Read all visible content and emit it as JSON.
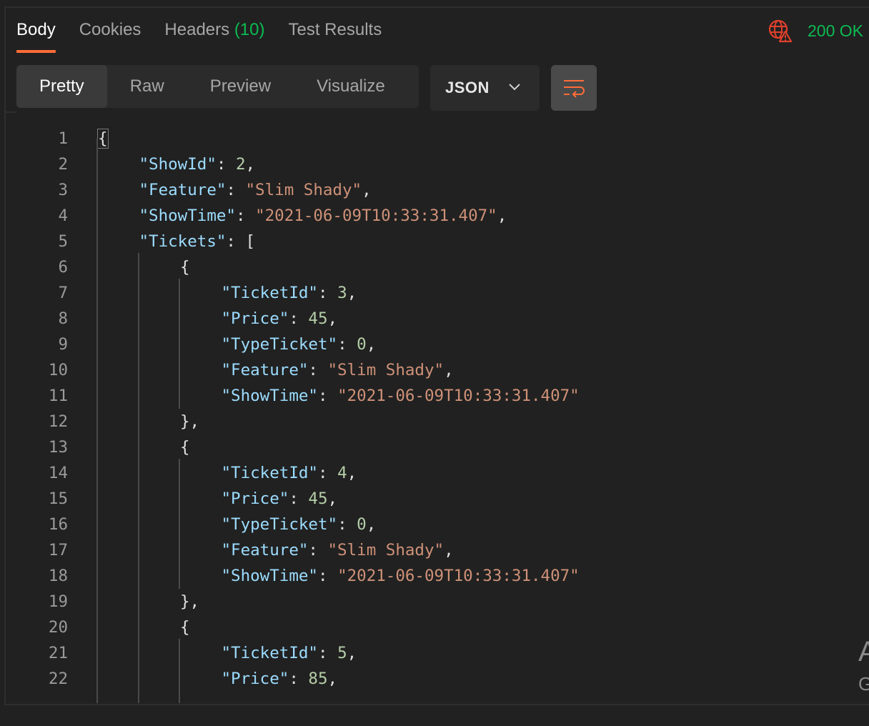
{
  "response_tabs": [
    {
      "label": "Body",
      "active": true
    },
    {
      "label": "Cookies",
      "active": false
    },
    {
      "label": "Headers ",
      "count": "(10)",
      "active": false
    },
    {
      "label": "Test Results",
      "active": false
    }
  ],
  "status": {
    "text": "200 OK",
    "color": "#0cbb52",
    "icon": "globe-warning-icon"
  },
  "view_modes": [
    {
      "label": "Pretty",
      "active": true
    },
    {
      "label": "Raw",
      "active": false
    },
    {
      "label": "Preview",
      "active": false
    },
    {
      "label": "Visualize",
      "active": false
    }
  ],
  "format": {
    "selected": "JSON",
    "icon": "chevron-down-icon"
  },
  "wrap_button": {
    "icon": "wrap-lines-icon"
  },
  "colors": {
    "accent": "#ff6c37",
    "json_key": "#9cdcfe",
    "json_string": "#ce9178",
    "json_number": "#b5cea8"
  },
  "code_lines": [
    {
      "n": "1",
      "indent": 0,
      "tokens": [
        {
          "t": "{",
          "c": "p",
          "hl": true
        }
      ]
    },
    {
      "n": "2",
      "indent": 1,
      "tokens": [
        {
          "t": "\"ShowId\"",
          "c": "k"
        },
        {
          "t": ": ",
          "c": "p"
        },
        {
          "t": "2",
          "c": "n"
        },
        {
          "t": ",",
          "c": "p"
        }
      ]
    },
    {
      "n": "3",
      "indent": 1,
      "tokens": [
        {
          "t": "\"Feature\"",
          "c": "k"
        },
        {
          "t": ": ",
          "c": "p"
        },
        {
          "t": "\"Slim Shady\"",
          "c": "s"
        },
        {
          "t": ",",
          "c": "p"
        }
      ]
    },
    {
      "n": "4",
      "indent": 1,
      "tokens": [
        {
          "t": "\"ShowTime\"",
          "c": "k"
        },
        {
          "t": ": ",
          "c": "p"
        },
        {
          "t": "\"2021-06-09T10:33:31.407\"",
          "c": "s"
        },
        {
          "t": ",",
          "c": "p"
        }
      ]
    },
    {
      "n": "5",
      "indent": 1,
      "tokens": [
        {
          "t": "\"Tickets\"",
          "c": "k"
        },
        {
          "t": ": [",
          "c": "p"
        }
      ]
    },
    {
      "n": "6",
      "indent": 2,
      "tokens": [
        {
          "t": "{",
          "c": "p"
        }
      ]
    },
    {
      "n": "7",
      "indent": 3,
      "tokens": [
        {
          "t": "\"TicketId\"",
          "c": "k"
        },
        {
          "t": ": ",
          "c": "p"
        },
        {
          "t": "3",
          "c": "n"
        },
        {
          "t": ",",
          "c": "p"
        }
      ]
    },
    {
      "n": "8",
      "indent": 3,
      "tokens": [
        {
          "t": "\"Price\"",
          "c": "k"
        },
        {
          "t": ": ",
          "c": "p"
        },
        {
          "t": "45",
          "c": "n"
        },
        {
          "t": ",",
          "c": "p"
        }
      ]
    },
    {
      "n": "9",
      "indent": 3,
      "tokens": [
        {
          "t": "\"TypeTicket\"",
          "c": "k"
        },
        {
          "t": ": ",
          "c": "p"
        },
        {
          "t": "0",
          "c": "n"
        },
        {
          "t": ",",
          "c": "p"
        }
      ]
    },
    {
      "n": "10",
      "indent": 3,
      "tokens": [
        {
          "t": "\"Feature\"",
          "c": "k"
        },
        {
          "t": ": ",
          "c": "p"
        },
        {
          "t": "\"Slim Shady\"",
          "c": "s"
        },
        {
          "t": ",",
          "c": "p"
        }
      ]
    },
    {
      "n": "11",
      "indent": 3,
      "tokens": [
        {
          "t": "\"ShowTime\"",
          "c": "k"
        },
        {
          "t": ": ",
          "c": "p"
        },
        {
          "t": "\"2021-06-09T10:33:31.407\"",
          "c": "s"
        }
      ]
    },
    {
      "n": "12",
      "indent": 2,
      "tokens": [
        {
          "t": "},",
          "c": "p"
        }
      ]
    },
    {
      "n": "13",
      "indent": 2,
      "tokens": [
        {
          "t": "{",
          "c": "p"
        }
      ]
    },
    {
      "n": "14",
      "indent": 3,
      "tokens": [
        {
          "t": "\"TicketId\"",
          "c": "k"
        },
        {
          "t": ": ",
          "c": "p"
        },
        {
          "t": "4",
          "c": "n"
        },
        {
          "t": ",",
          "c": "p"
        }
      ]
    },
    {
      "n": "15",
      "indent": 3,
      "tokens": [
        {
          "t": "\"Price\"",
          "c": "k"
        },
        {
          "t": ": ",
          "c": "p"
        },
        {
          "t": "45",
          "c": "n"
        },
        {
          "t": ",",
          "c": "p"
        }
      ]
    },
    {
      "n": "16",
      "indent": 3,
      "tokens": [
        {
          "t": "\"TypeTicket\"",
          "c": "k"
        },
        {
          "t": ": ",
          "c": "p"
        },
        {
          "t": "0",
          "c": "n"
        },
        {
          "t": ",",
          "c": "p"
        }
      ]
    },
    {
      "n": "17",
      "indent": 3,
      "tokens": [
        {
          "t": "\"Feature\"",
          "c": "k"
        },
        {
          "t": ": ",
          "c": "p"
        },
        {
          "t": "\"Slim Shady\"",
          "c": "s"
        },
        {
          "t": ",",
          "c": "p"
        }
      ]
    },
    {
      "n": "18",
      "indent": 3,
      "tokens": [
        {
          "t": "\"ShowTime\"",
          "c": "k"
        },
        {
          "t": ": ",
          "c": "p"
        },
        {
          "t": "\"2021-06-09T10:33:31.407\"",
          "c": "s"
        }
      ]
    },
    {
      "n": "19",
      "indent": 2,
      "tokens": [
        {
          "t": "},",
          "c": "p"
        }
      ]
    },
    {
      "n": "20",
      "indent": 2,
      "tokens": [
        {
          "t": "{",
          "c": "p"
        }
      ]
    },
    {
      "n": "21",
      "indent": 3,
      "tokens": [
        {
          "t": "\"TicketId\"",
          "c": "k"
        },
        {
          "t": ": ",
          "c": "p"
        },
        {
          "t": "5",
          "c": "n"
        },
        {
          "t": ",",
          "c": "p"
        }
      ]
    },
    {
      "n": "22",
      "indent": 3,
      "tokens": [
        {
          "t": "\"Price\"",
          "c": "k"
        },
        {
          "t": ": ",
          "c": "p"
        },
        {
          "t": "85",
          "c": "n"
        },
        {
          "t": ",",
          "c": "p"
        }
      ]
    }
  ],
  "side_glyphs": [
    "A",
    "G"
  ]
}
